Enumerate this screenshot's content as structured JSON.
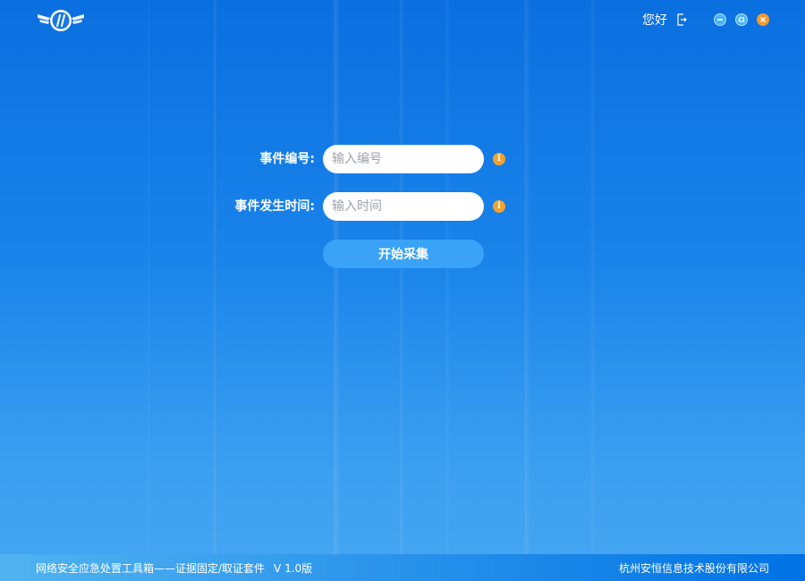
{
  "header": {
    "logo_icon": "wings-logo-icon",
    "greeting": "您好",
    "logout_icon": "logout-icon",
    "window_controls": {
      "minimize": "minimize-icon",
      "maximize": "maximize-icon",
      "close": "close-icon"
    }
  },
  "form": {
    "event_id": {
      "label": "事件编号:",
      "placeholder": "输入编号",
      "info_icon": "info-icon",
      "info_glyph": "i"
    },
    "event_time": {
      "label": "事件发生时间:",
      "placeholder": "输入时间",
      "info_icon": "info-icon",
      "info_glyph": "i"
    },
    "start_button": "开始采集"
  },
  "footer": {
    "title": "网络安全应急处置工具箱——证据固定/取证套件",
    "version": "V 1.0版",
    "company": "杭州安恒信息技术股份有限公司"
  },
  "colors": {
    "accent_orange": "#f59a2e",
    "button_blue": "#3aa3f7",
    "footer_gradient_left": "#51b3f1",
    "footer_gradient_right": "#0072e4",
    "text": "#ffffff"
  }
}
